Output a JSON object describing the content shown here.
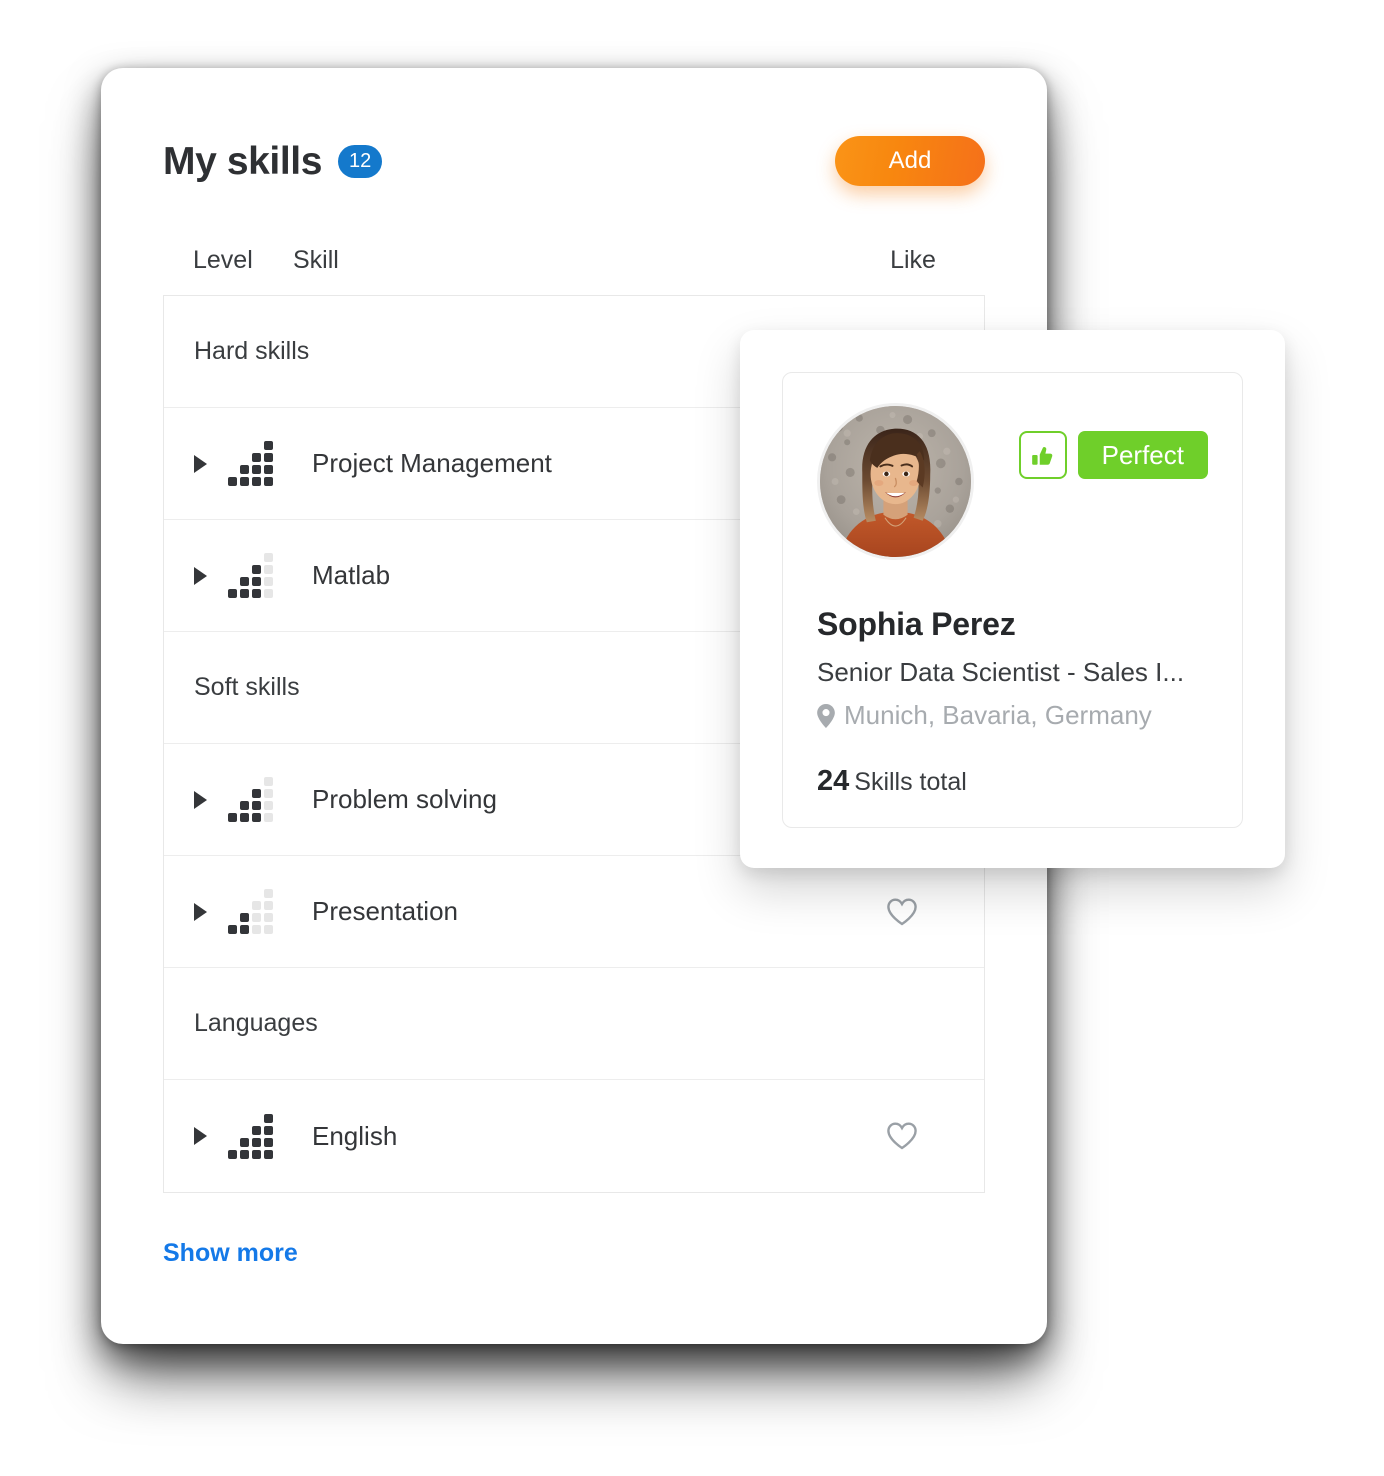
{
  "skills_panel": {
    "title": "My skills",
    "count_badge": "12",
    "add_label": "Add",
    "columns": {
      "level": "Level",
      "skill": "Skill",
      "like": "Like"
    },
    "rows": [
      {
        "kind": "section",
        "label": "Hard skills"
      },
      {
        "kind": "skill",
        "label": "Project Management",
        "level": 4,
        "max_level": 4,
        "liked": false
      },
      {
        "kind": "skill",
        "label": "Matlab",
        "level": 3,
        "max_level": 4,
        "liked": false
      },
      {
        "kind": "section",
        "label": "Soft skills"
      },
      {
        "kind": "skill",
        "label": "Problem solving",
        "level": 3,
        "max_level": 4,
        "liked": false
      },
      {
        "kind": "skill",
        "label": "Presentation",
        "level": 2,
        "max_level": 4,
        "liked": false
      },
      {
        "kind": "section",
        "label": "Languages"
      },
      {
        "kind": "skill",
        "label": "English",
        "level": 4,
        "max_level": 4,
        "liked": false
      }
    ],
    "show_more_label": "Show more"
  },
  "profile_card": {
    "name": "Sophia Perez",
    "role": "Senior Data Scientist - Sales I...",
    "location": "Munich, Bavaria, Germany",
    "skills_count": "24",
    "skills_count_label": "Skills total",
    "rating_label": "Perfect",
    "thumb_icon": "thumbs-up-icon",
    "pin_icon": "location-pin-icon"
  },
  "colors": {
    "accent_blue": "#1479cc",
    "link_blue": "#1479e8",
    "add_orange_from": "#fa9417",
    "add_orange_to": "#f5701a",
    "rating_green": "#6fcf2a",
    "dot_on": "#333539",
    "dot_off": "#e6e6e6",
    "text_dark": "#343639",
    "text_muted": "#a7abaf"
  }
}
